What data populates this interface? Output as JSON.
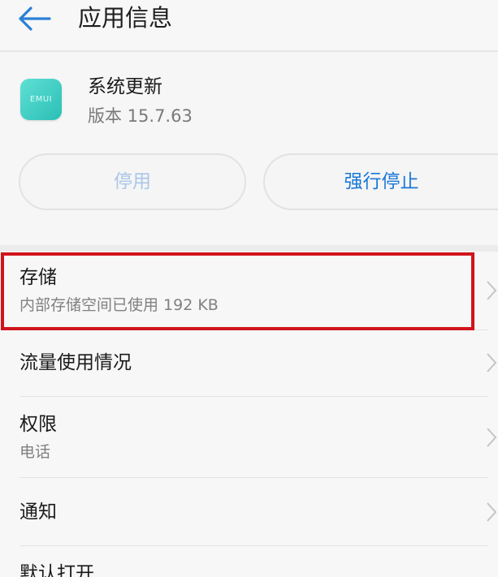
{
  "header": {
    "title": "应用信息",
    "back_icon": "arrow-left-icon"
  },
  "app": {
    "name": "系统更新",
    "version": "版本 15.7.63",
    "icon_text": "EMUI",
    "icon_color": "#3ccfc4"
  },
  "buttons": {
    "disable": "停用",
    "force_stop": "强行停止"
  },
  "settings": [
    {
      "title": "存储",
      "subtitle": "内部存储空间已使用 192 KB"
    },
    {
      "title": "流量使用情况",
      "subtitle": ""
    },
    {
      "title": "权限",
      "subtitle": "电话"
    },
    {
      "title": "通知",
      "subtitle": ""
    },
    {
      "title": "默认打开",
      "subtitle": ""
    }
  ],
  "colors": {
    "accent": "#1a78d6",
    "highlight": "#d0141c",
    "disabled_text": "#a9c6e8"
  }
}
